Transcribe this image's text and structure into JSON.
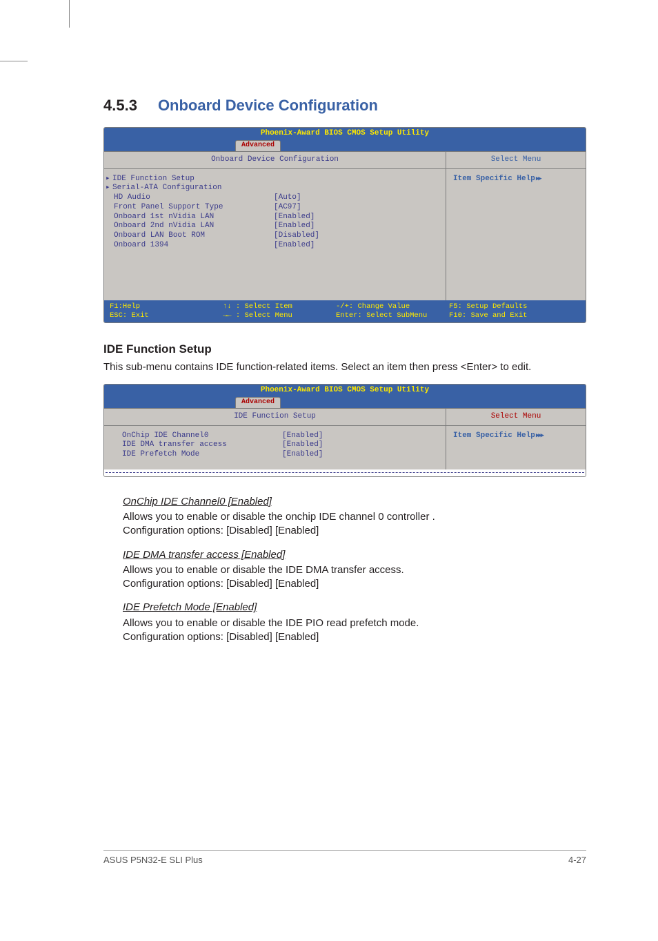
{
  "section": {
    "num": "4.5.3",
    "title": "Onboard Device Configuration"
  },
  "bios1": {
    "top": "Phoenix-Award BIOS CMOS Setup Utility",
    "tab": "Advanced",
    "subleft": "Onboard Device Configuration",
    "subright": "Select Menu",
    "help": "Item Specific Help",
    "rows": [
      {
        "label": "IDE Function Setup",
        "value": "",
        "tri": true
      },
      {
        "label": "Serial-ATA Configuration",
        "value": "",
        "tri": true
      },
      {
        "label": "HD Audio",
        "value": "[Auto]"
      },
      {
        "label": "Front Panel Support Type",
        "value": "[AC97]"
      },
      {
        "label": "Onboard 1st nVidia LAN",
        "value": "[Enabled]"
      },
      {
        "label": "Onboard 2nd nVidia LAN",
        "value": "[Enabled]"
      },
      {
        "label": "Onboard LAN Boot ROM",
        "value": "[Disabled]"
      },
      {
        "label": "Onboard 1394",
        "value": "[Enabled]"
      }
    ],
    "foot": {
      "c1a": "F1:Help",
      "c1b": "ESC: Exit",
      "c2a": "↑↓ : Select Item",
      "c2b": "→← : Select Menu",
      "c3a": "-/+: Change Value",
      "c3b": "Enter: Select SubMenu",
      "c4a": "F5: Setup Defaults",
      "c4b": "F10: Save and Exit"
    }
  },
  "ide_heading": "IDE Function Setup",
  "ide_para": "This sub-menu contains IDE function-related items. Select an item then press <Enter> to edit.",
  "bios2": {
    "top": "Phoenix-Award BIOS CMOS Setup Utility",
    "tab": "Advanced",
    "subleft": "IDE Function Setup",
    "subright": "Select Menu",
    "help": "Item Specific Help",
    "rows": [
      {
        "label": "OnChip IDE Channel0",
        "value": "[Enabled]"
      },
      {
        "label": "IDE DMA transfer access",
        "value": "[Enabled]"
      },
      {
        "label": "IDE Prefetch Mode",
        "value": "[Enabled]"
      }
    ]
  },
  "items": [
    {
      "title": "OnChip IDE Channel0 [Enabled]",
      "line1": "Allows you to enable or disable the onchip IDE channel 0 controller .",
      "line2": "Configuration options: [Disabled] [Enabled]"
    },
    {
      "title": "IDE DMA transfer access [Enabled]",
      "line1": "Allows you to enable or disable the IDE DMA transfer access.",
      "line2": "Configuration options: [Disabled] [Enabled]"
    },
    {
      "title": "IDE Prefetch Mode [Enabled]",
      "line1": "Allows you to enable or disable the IDE PIO read prefetch mode.",
      "line2": "Configuration options: [Disabled] [Enabled]"
    }
  ],
  "footer": {
    "left": "ASUS P5N32-E SLI Plus",
    "right": "4-27"
  }
}
